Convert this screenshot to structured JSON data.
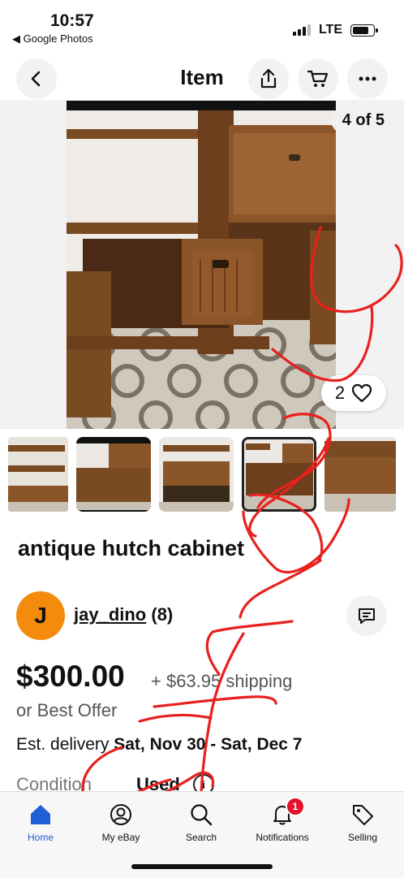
{
  "status": {
    "time": "10:57",
    "back_app": "◀ Google Photos",
    "network": "LTE"
  },
  "header": {
    "title": "Item"
  },
  "gallery": {
    "counter": "4 of 5",
    "likes": "2"
  },
  "listing": {
    "title": "antique hutch cabinet",
    "seller_initial": "J",
    "seller_name": "jay_dino",
    "seller_feedback": "(8)",
    "price": "$300.00",
    "shipping": "+ $63.95 shipping",
    "best_offer": "or Best Offer",
    "delivery_label": "Est. delivery",
    "delivery_dates": "Sat, Nov 30 - Sat, Dec 7",
    "condition_label": "Condition",
    "condition_value": "Used",
    "info_glyph": "i"
  },
  "tabs": [
    {
      "label": "Home",
      "icon": "home-icon"
    },
    {
      "label": "My eBay",
      "icon": "user-icon"
    },
    {
      "label": "Search",
      "icon": "search-icon"
    },
    {
      "label": "Notifications",
      "icon": "bell-icon",
      "badge": "1"
    },
    {
      "label": "Selling",
      "icon": "tag-icon"
    }
  ],
  "colors": {
    "accent": "#1f5fd6",
    "avatar": "#f58b0d",
    "badge": "#e0142b",
    "scribble": "#e8201e"
  }
}
